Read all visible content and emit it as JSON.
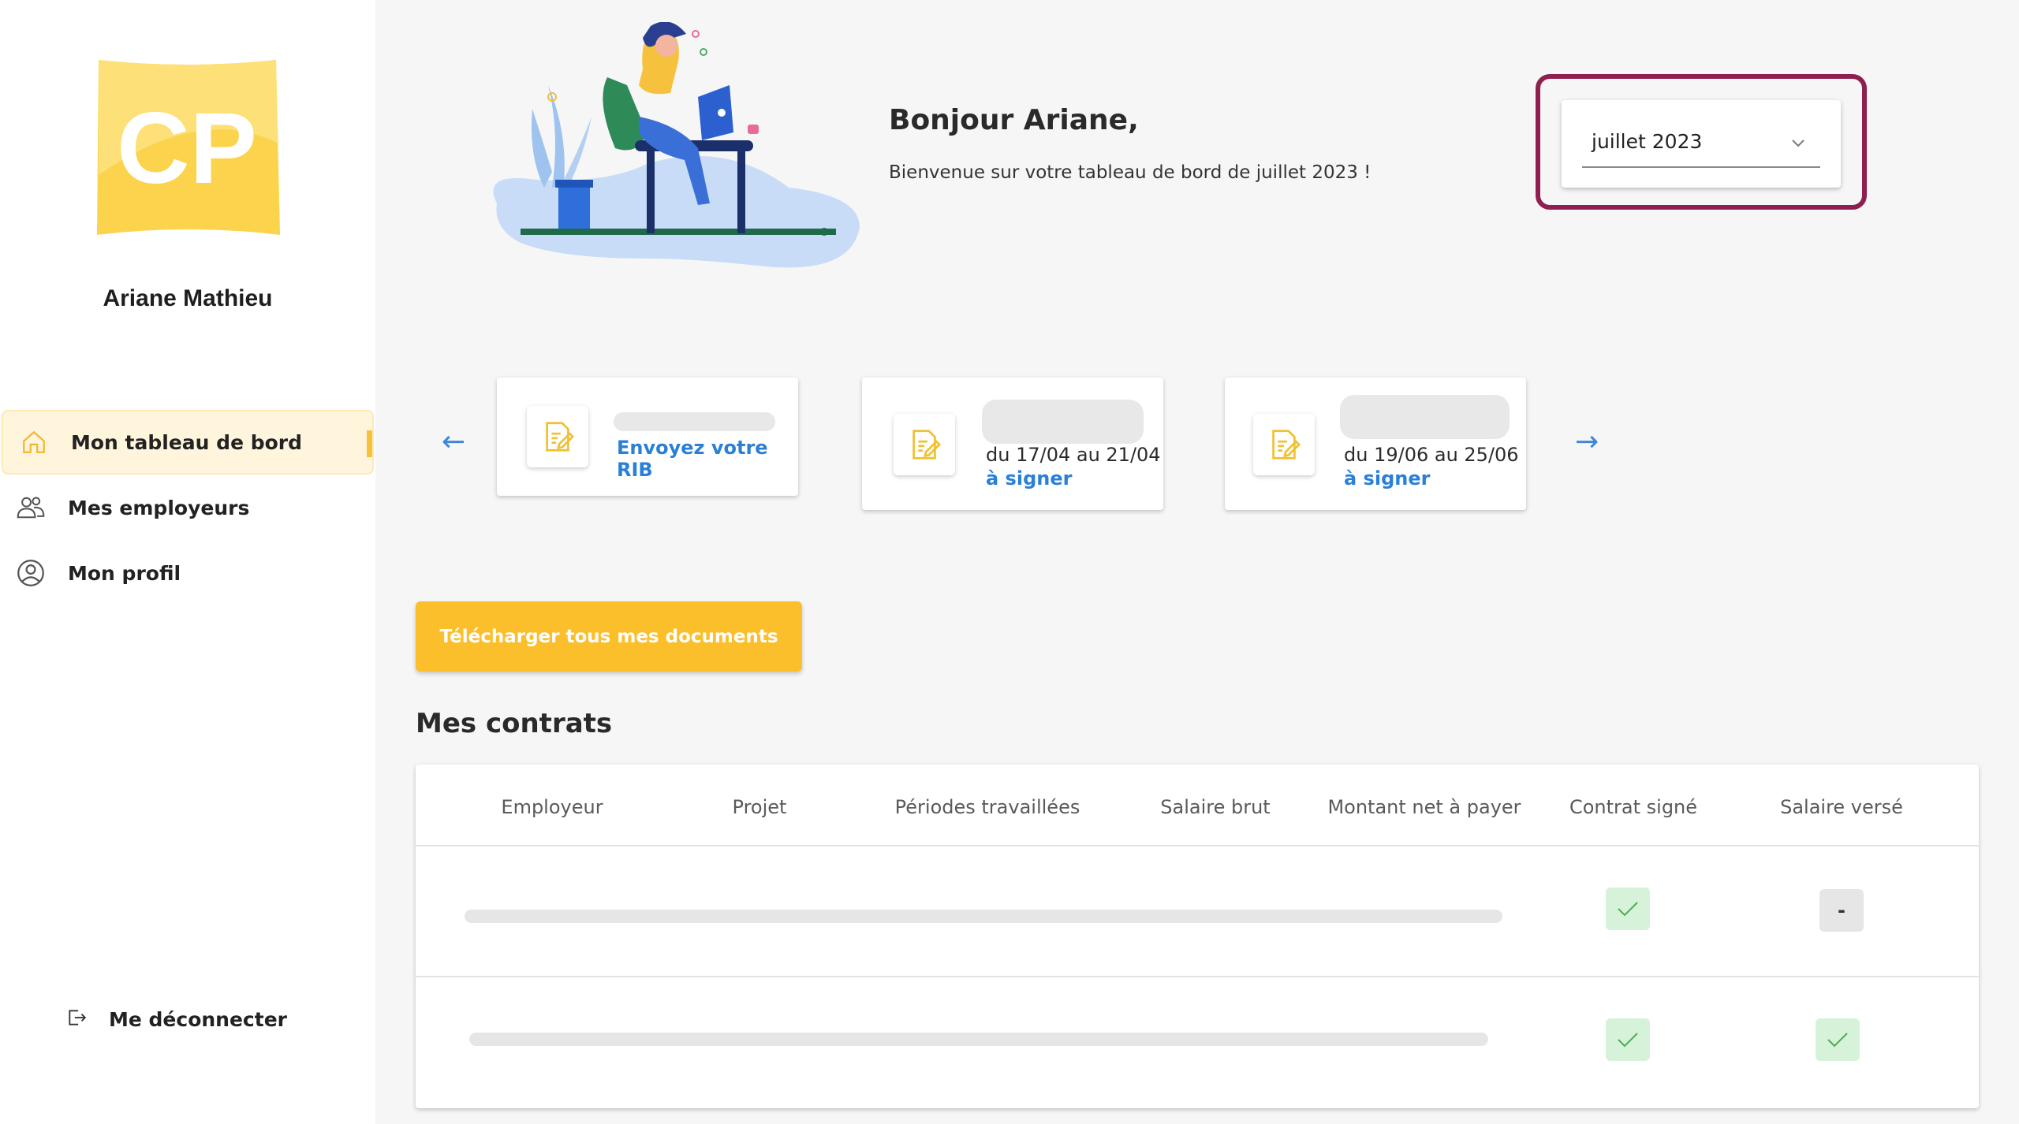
{
  "brand": {
    "logo_text": "CP",
    "logo_color": "#fcd34d"
  },
  "user": {
    "name": "Ariane Mathieu"
  },
  "sidebar": {
    "items": [
      {
        "label": "Mon tableau de bord",
        "icon": "home-icon",
        "active": true
      },
      {
        "label": "Mes employeurs",
        "icon": "users-icon",
        "active": false
      },
      {
        "label": "Mon profil",
        "icon": "user-circle-icon",
        "active": false
      }
    ],
    "logout_label": "Me déconnecter"
  },
  "header": {
    "greeting": "Bonjour Ariane,",
    "subtitle": "Bienvenue sur votre tableau de bord de juillet 2023 !"
  },
  "month_selector": {
    "value": "juillet 2023",
    "highlight_color": "#8e1f4f"
  },
  "carousel": {
    "prev_arrow": "←",
    "next_arrow": "→",
    "cards": [
      {
        "link": "Envoyez votre RIB"
      },
      {
        "dates": "du 17/04 au 21/04",
        "link": "à signer"
      },
      {
        "dates": "du 19/06 au 25/06",
        "link": "à signer"
      }
    ]
  },
  "download_button": {
    "label": "Télécharger tous mes documents",
    "color": "#fbbf2b"
  },
  "contracts": {
    "title": "Mes contrats",
    "columns": [
      "Employeur",
      "Projet",
      "Périodes travaillées",
      "Salaire brut",
      "Montant net à payer",
      "Contrat signé",
      "Salaire versé"
    ],
    "rows": [
      {
        "contrat_signe": "check",
        "salaire_verse": "-"
      },
      {
        "contrat_signe": "check",
        "salaire_verse": "check"
      }
    ]
  }
}
